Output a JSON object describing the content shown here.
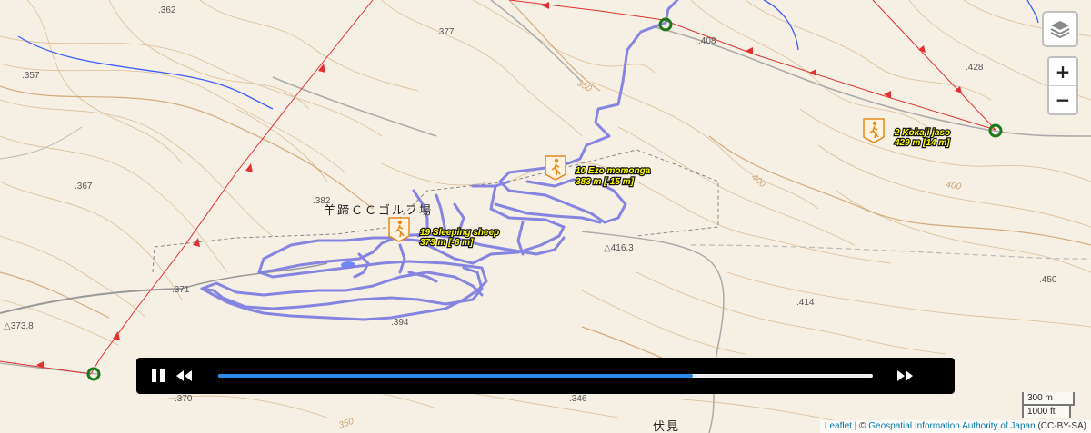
{
  "map": {
    "elevations": [
      ".362",
      ".377",
      ".357",
      ".367",
      ".382",
      ".408",
      ".428",
      ".371",
      "△373.8",
      "△416.3",
      ".414",
      ".450",
      ".394",
      ".370",
      ".346"
    ],
    "contour_labels": [
      "350",
      "400",
      "400",
      "350"
    ],
    "place_names": [
      "羊蹄ＣＣゴルフ場",
      "伏見"
    ],
    "route_color": "#7f7fe0",
    "boundary_color": "#e03030"
  },
  "waypoints": [
    {
      "icon": "hiker-icon",
      "name": "19 Sleeping sheep",
      "elevation": "373 m [-6 m]"
    },
    {
      "icon": "hiker-icon",
      "name": "10 Ezo momonga",
      "elevation": "383 m [-15 m]"
    },
    {
      "icon": "hiker-icon",
      "name": "2 Kokaji jaso",
      "elevation": "429 m [14 m]"
    }
  ],
  "controls": {
    "layers_icon": "layers-icon",
    "zoom_in": "+",
    "zoom_out": "−"
  },
  "player": {
    "pause_icon": "pause-icon",
    "rewind_icon": "rewind-icon",
    "forward_icon": "fast-forward-icon",
    "progress": 0.725,
    "progress_color": "#2b88e6"
  },
  "scale": {
    "metric": "300 m",
    "imperial": "1000 ft"
  },
  "attribution": {
    "leaflet": "Leaflet",
    "separator": " | © ",
    "provider": "Geospatial Information Authority of Japan",
    "license": " (CC-BY-SA)"
  }
}
